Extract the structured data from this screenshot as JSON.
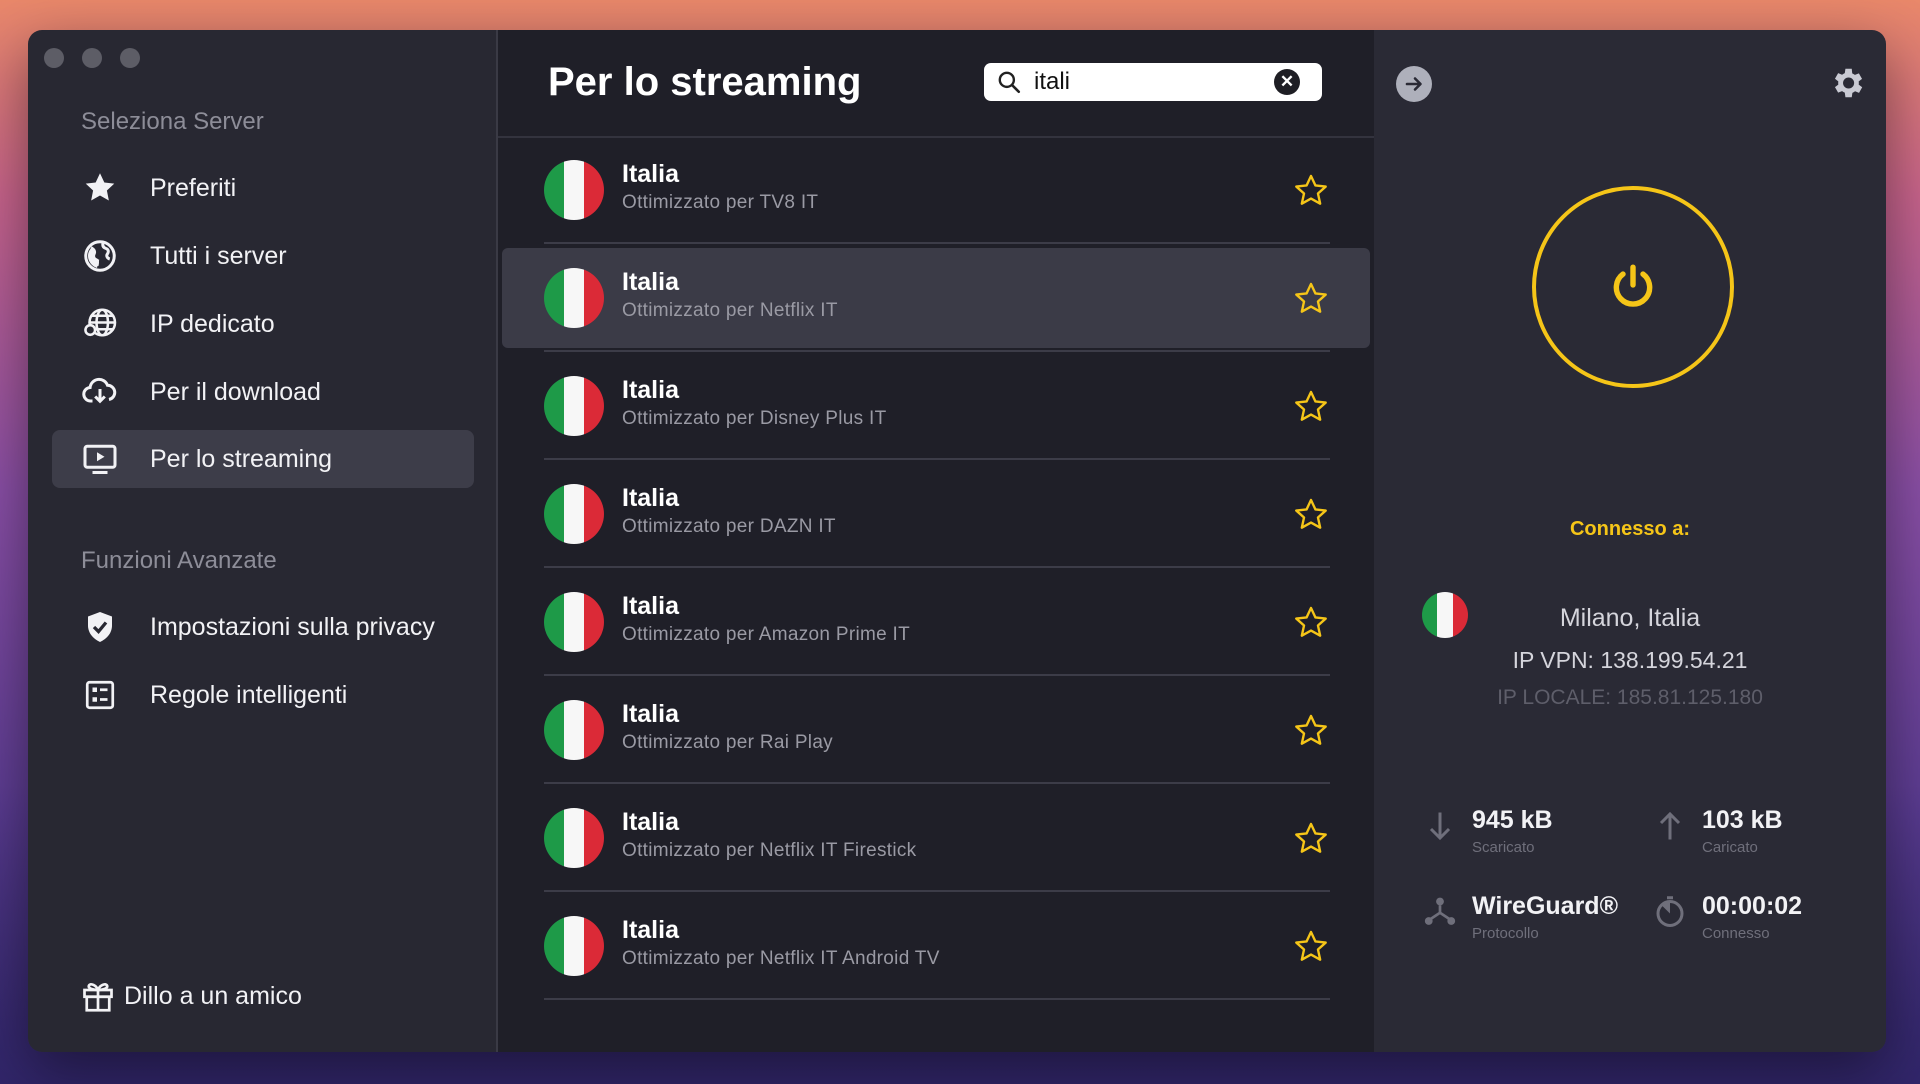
{
  "sidebar": {
    "section_select": "Seleziona Server",
    "items": [
      {
        "label": "Preferiti",
        "icon": "star-icon"
      },
      {
        "label": "Tutti i server",
        "icon": "globe-icon"
      },
      {
        "label": "IP dedicato",
        "icon": "globe-network-icon"
      },
      {
        "label": "Per il download",
        "icon": "cloud-download-icon"
      },
      {
        "label": "Per lo streaming",
        "icon": "tv-play-icon",
        "active": true
      }
    ],
    "section_advanced": "Funzioni Avanzate",
    "advanced_items": [
      {
        "label": "Impostazioni sulla privacy",
        "icon": "shield-check-icon"
      },
      {
        "label": "Regole intelligenti",
        "icon": "rules-icon"
      }
    ],
    "invite_label": "Dillo a un amico"
  },
  "list": {
    "title": "Per lo streaming",
    "search": {
      "value": "itali",
      "placeholder": ""
    },
    "servers": [
      {
        "name": "Italia",
        "desc": "Ottimizzato per TV8 IT"
      },
      {
        "name": "Italia",
        "desc": "Ottimizzato per Netflix IT",
        "selected": true
      },
      {
        "name": "Italia",
        "desc": "Ottimizzato per Disney Plus IT"
      },
      {
        "name": "Italia",
        "desc": "Ottimizzato per DAZN IT"
      },
      {
        "name": "Italia",
        "desc": "Ottimizzato per Amazon Prime IT"
      },
      {
        "name": "Italia",
        "desc": "Ottimizzato per Rai Play"
      },
      {
        "name": "Italia",
        "desc": "Ottimizzato per Netflix IT Firestick"
      },
      {
        "name": "Italia",
        "desc": "Ottimizzato per Netflix IT Android TV"
      }
    ]
  },
  "status": {
    "connected_label": "Connesso a:",
    "city": "Milano, Italia",
    "vpn_ip": "IP VPN: 138.199.54.21",
    "local_ip": "IP LOCALE: 185.81.125.180",
    "download": {
      "value": "945 kB",
      "label": "Scaricato"
    },
    "upload": {
      "value": "103 kB",
      "label": "Caricato"
    },
    "protocol": {
      "value": "WireGuard®",
      "label": "Protocollo"
    },
    "duration": {
      "value": "00:00:02",
      "label": "Connesso"
    }
  },
  "colors": {
    "accent": "#f5c518",
    "sidebar_bg": "#282832",
    "list_bg": "#1f1f28",
    "status_bg": "#2a2a35"
  }
}
